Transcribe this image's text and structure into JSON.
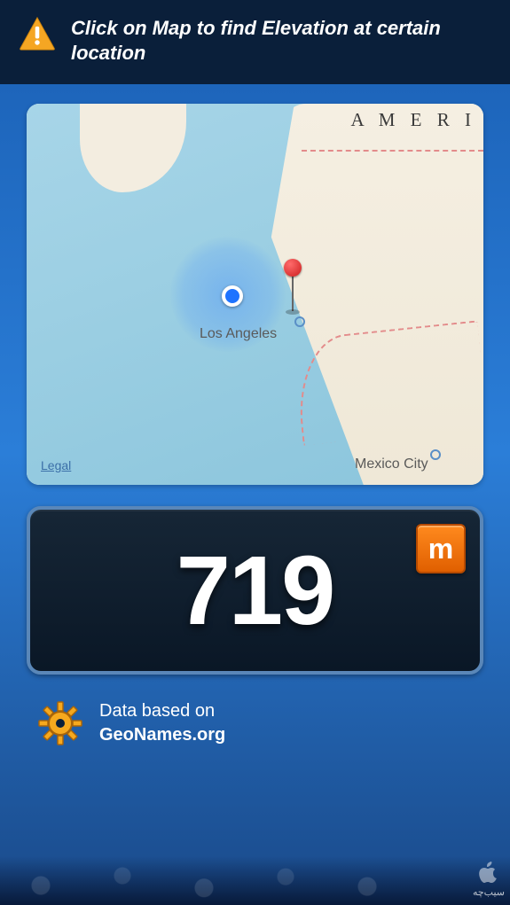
{
  "header": {
    "warning_text": "Click on Map to find Elevation at certain location"
  },
  "map": {
    "label_top_right": "A M E R I",
    "city_la": "Los Angeles",
    "city_mex": "Mexico City",
    "legal_link": "Legal"
  },
  "readout": {
    "elevation_value": "719",
    "unit_label": "m"
  },
  "attribution": {
    "line1": "Data based on",
    "line2": "GeoNames.org"
  },
  "watermark": {
    "text": "سیب‌چه"
  }
}
